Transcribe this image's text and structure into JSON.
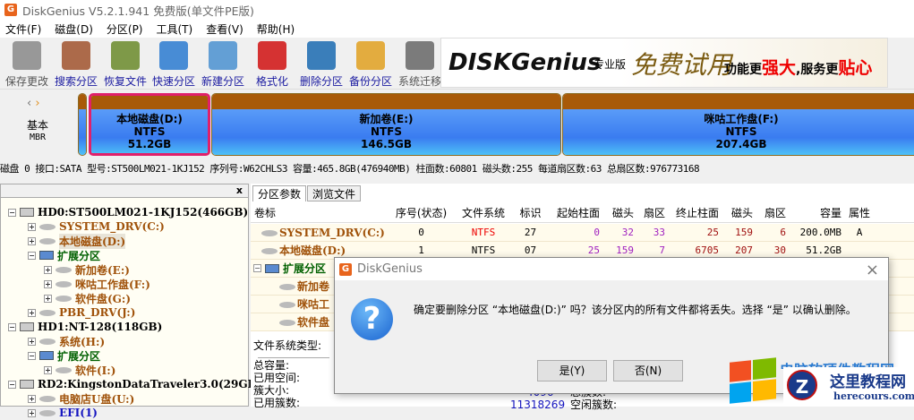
{
  "window": {
    "title": "DiskGenius V5.2.1.941 免费版(单文件PE版)",
    "logo_letter": "G"
  },
  "menu": [
    "文件(F)",
    "磁盘(D)",
    "分区(P)",
    "工具(T)",
    "查看(V)",
    "帮助(H)"
  ],
  "toolbar": [
    {
      "label": "保存更改",
      "icon": "save-icon",
      "color": "#888888"
    },
    {
      "label": "搜索分区",
      "icon": "search-icon",
      "color": "#a0522d"
    },
    {
      "label": "恢复文件",
      "icon": "recover-icon",
      "color": "#6a8a2a"
    },
    {
      "label": "快速分区",
      "icon": "quick-partition-icon",
      "color": "#2a7ad0"
    },
    {
      "label": "新建分区",
      "icon": "new-partition-icon",
      "color": "#4a90d0"
    },
    {
      "label": "格式化",
      "icon": "format-icon",
      "color": "#d01010"
    },
    {
      "label": "删除分区",
      "icon": "delete-icon",
      "color": "#1a6ab0"
    },
    {
      "label": "备份分区",
      "icon": "backup-icon",
      "color": "#e0a020"
    },
    {
      "label": "系统迁移",
      "icon": "migrate-icon",
      "color": "#666666"
    }
  ],
  "banner": {
    "brand": "DISKGenius",
    "edition": "专业版",
    "slogan1": "免费试用",
    "slogan2": "功能更",
    "slogan3": "强大",
    "slogan4": ",服务更",
    "slogan5": "贴心"
  },
  "diskmap": {
    "type1": "基本",
    "type2": "MBR",
    "partitions": [
      {
        "name": "本地磁盘(D:)",
        "fs": "NTFS",
        "size": "51.2GB"
      },
      {
        "name": "新加卷(E:)",
        "fs": "NTFS",
        "size": "146.5GB"
      },
      {
        "name": "咪咕工作盘(F:)",
        "fs": "NTFS",
        "size": "207.4GB"
      }
    ]
  },
  "diskinfo": "磁盘 0 接口:SATA  型号:ST500LM021-1KJ152  序列号:W62CHLS3  容量:465.8GB(476940MB)  柱面数:60801  磁头数:255  每道扇区数:63  总扇区数:976773168",
  "tree": {
    "close": "x",
    "items": [
      {
        "label": "HD0:ST500LM021-1KJ152(466GB)",
        "type": "hd"
      },
      {
        "label": "SYSTEM_DRV(C:)",
        "type": "part"
      },
      {
        "label": "本地磁盘(D:)",
        "type": "part"
      },
      {
        "label": "扩展分区",
        "type": "ext"
      },
      {
        "label": "新加卷(E:)",
        "type": "part"
      },
      {
        "label": "咪咕工作盘(F:)",
        "type": "part"
      },
      {
        "label": "软件盘(G:)",
        "type": "part"
      },
      {
        "label": "PBR_DRV(J:)",
        "type": "part"
      },
      {
        "label": "HD1:NT-128(118GB)",
        "type": "hd"
      },
      {
        "label": "系统(H:)",
        "type": "part"
      },
      {
        "label": "扩展分区",
        "type": "ext"
      },
      {
        "label": "软件(I:)",
        "type": "part"
      },
      {
        "label": "RD2:KingstonDataTraveler3.0(29GB)",
        "type": "hd"
      },
      {
        "label": "电脑店U盘(U:)",
        "type": "part"
      },
      {
        "label": "EFI(1)",
        "type": "part"
      }
    ]
  },
  "tabs": [
    "分区参数",
    "浏览文件"
  ],
  "table": {
    "headers": [
      "卷标",
      "序号(状态)",
      "文件系统",
      "标识",
      "起始柱面",
      "磁头",
      "扇区",
      "终止柱面",
      "磁头",
      "扇区",
      "容量",
      "属性"
    ],
    "rows": [
      [
        "SYSTEM_DRV(C:)",
        "0",
        "NTFS",
        "27",
        "0",
        "32",
        "33",
        "25",
        "159",
        "6",
        "200.0MB",
        "A"
      ],
      [
        "本地磁盘(D:)",
        "1",
        "NTFS",
        "07",
        "25",
        "159",
        "7",
        "6705",
        "207",
        "30",
        "51.2GB",
        ""
      ]
    ],
    "ext_rows": [
      "扩展分区",
      "新加卷",
      "咪咕工",
      "软件盘"
    ]
  },
  "details": {
    "fs_type": "文件系统类型:",
    "total": "总容量:",
    "used": "已用空间:",
    "cluster_size": "簇大小:",
    "used_clusters": "已用簇数:",
    "cluster_size_val": "4096",
    "used_clusters_val": "11318269",
    "total_clusters": "总簇数:",
    "free_clusters": "空闲簇数:"
  },
  "dialog": {
    "title": "DiskGenius",
    "message": "确定要删除分区 “本地磁盘(D:)” 吗？该分区内的所有文件都将丢失。选择 “是” 以确认删除。",
    "yes": "是(Y)",
    "no": "否(N)",
    "close": "×",
    "icon_glyph": "?"
  },
  "watermark": {
    "site_name": "这里教程网",
    "domain": "herecours.com",
    "partial": "电脑软硬件教程网"
  }
}
